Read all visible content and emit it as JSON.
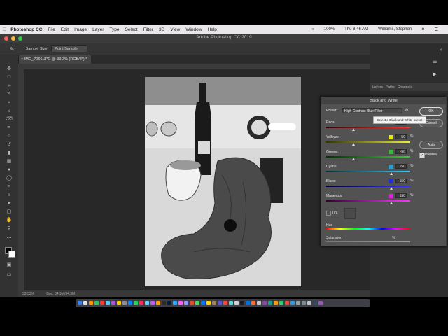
{
  "menubar": {
    "app_name": "Photoshop CC",
    "items": [
      "File",
      "Edit",
      "Image",
      "Layer",
      "Type",
      "Select",
      "Filter",
      "3D",
      "View",
      "Window",
      "Help"
    ],
    "battery": "100%",
    "clock": "Thu 8:46 AM",
    "user": "Williams, Stephen"
  },
  "window": {
    "title": "Adobe Photoshop CC 2019"
  },
  "options_bar": {
    "sample_size_label": "Sample Size:",
    "sample_size_value": "Point Sample"
  },
  "document": {
    "tab_title": "IMG_7066.JPG @ 33.3% (RGB/8*) *"
  },
  "status_bar": {
    "zoom": "33.33%",
    "doc_size": "Doc: 34.9M/34.9M"
  },
  "panels": {
    "tabs": [
      "Layers",
      "Paths",
      "Channels"
    ]
  },
  "dialog": {
    "title": "Black and White",
    "preset_label": "Preset:",
    "preset_value": "High Contrast Blue Filter",
    "ok_label": "OK",
    "cancel_label": "Cancel",
    "auto_label": "Auto",
    "preview_label": "Preview",
    "preview_checked": true,
    "tooltip": "Select a Black and White preset",
    "sliders": [
      {
        "name": "reds",
        "label": "Reds:",
        "value": "",
        "swatch": "#e02020",
        "position": 0.33
      },
      {
        "name": "yellows",
        "label": "Yellows:",
        "value": "-50",
        "swatch": "#e8e800",
        "position": 0.33
      },
      {
        "name": "greens",
        "label": "Greens:",
        "value": "-50",
        "swatch": "#30c030",
        "position": 0.33
      },
      {
        "name": "cyans",
        "label": "Cyans:",
        "value": "150",
        "swatch": "#20a0e0",
        "position": 0.78
      },
      {
        "name": "blues",
        "label": "Blues:",
        "value": "150",
        "swatch": "#2030e0",
        "position": 0.78
      },
      {
        "name": "magentas",
        "label": "Magentas:",
        "value": "150",
        "swatch": "#e020e0",
        "position": 0.78
      }
    ],
    "pct_sign": "%",
    "tint_label": "Tint",
    "hue_label": "Hue",
    "saturation_label": "Saturation"
  }
}
